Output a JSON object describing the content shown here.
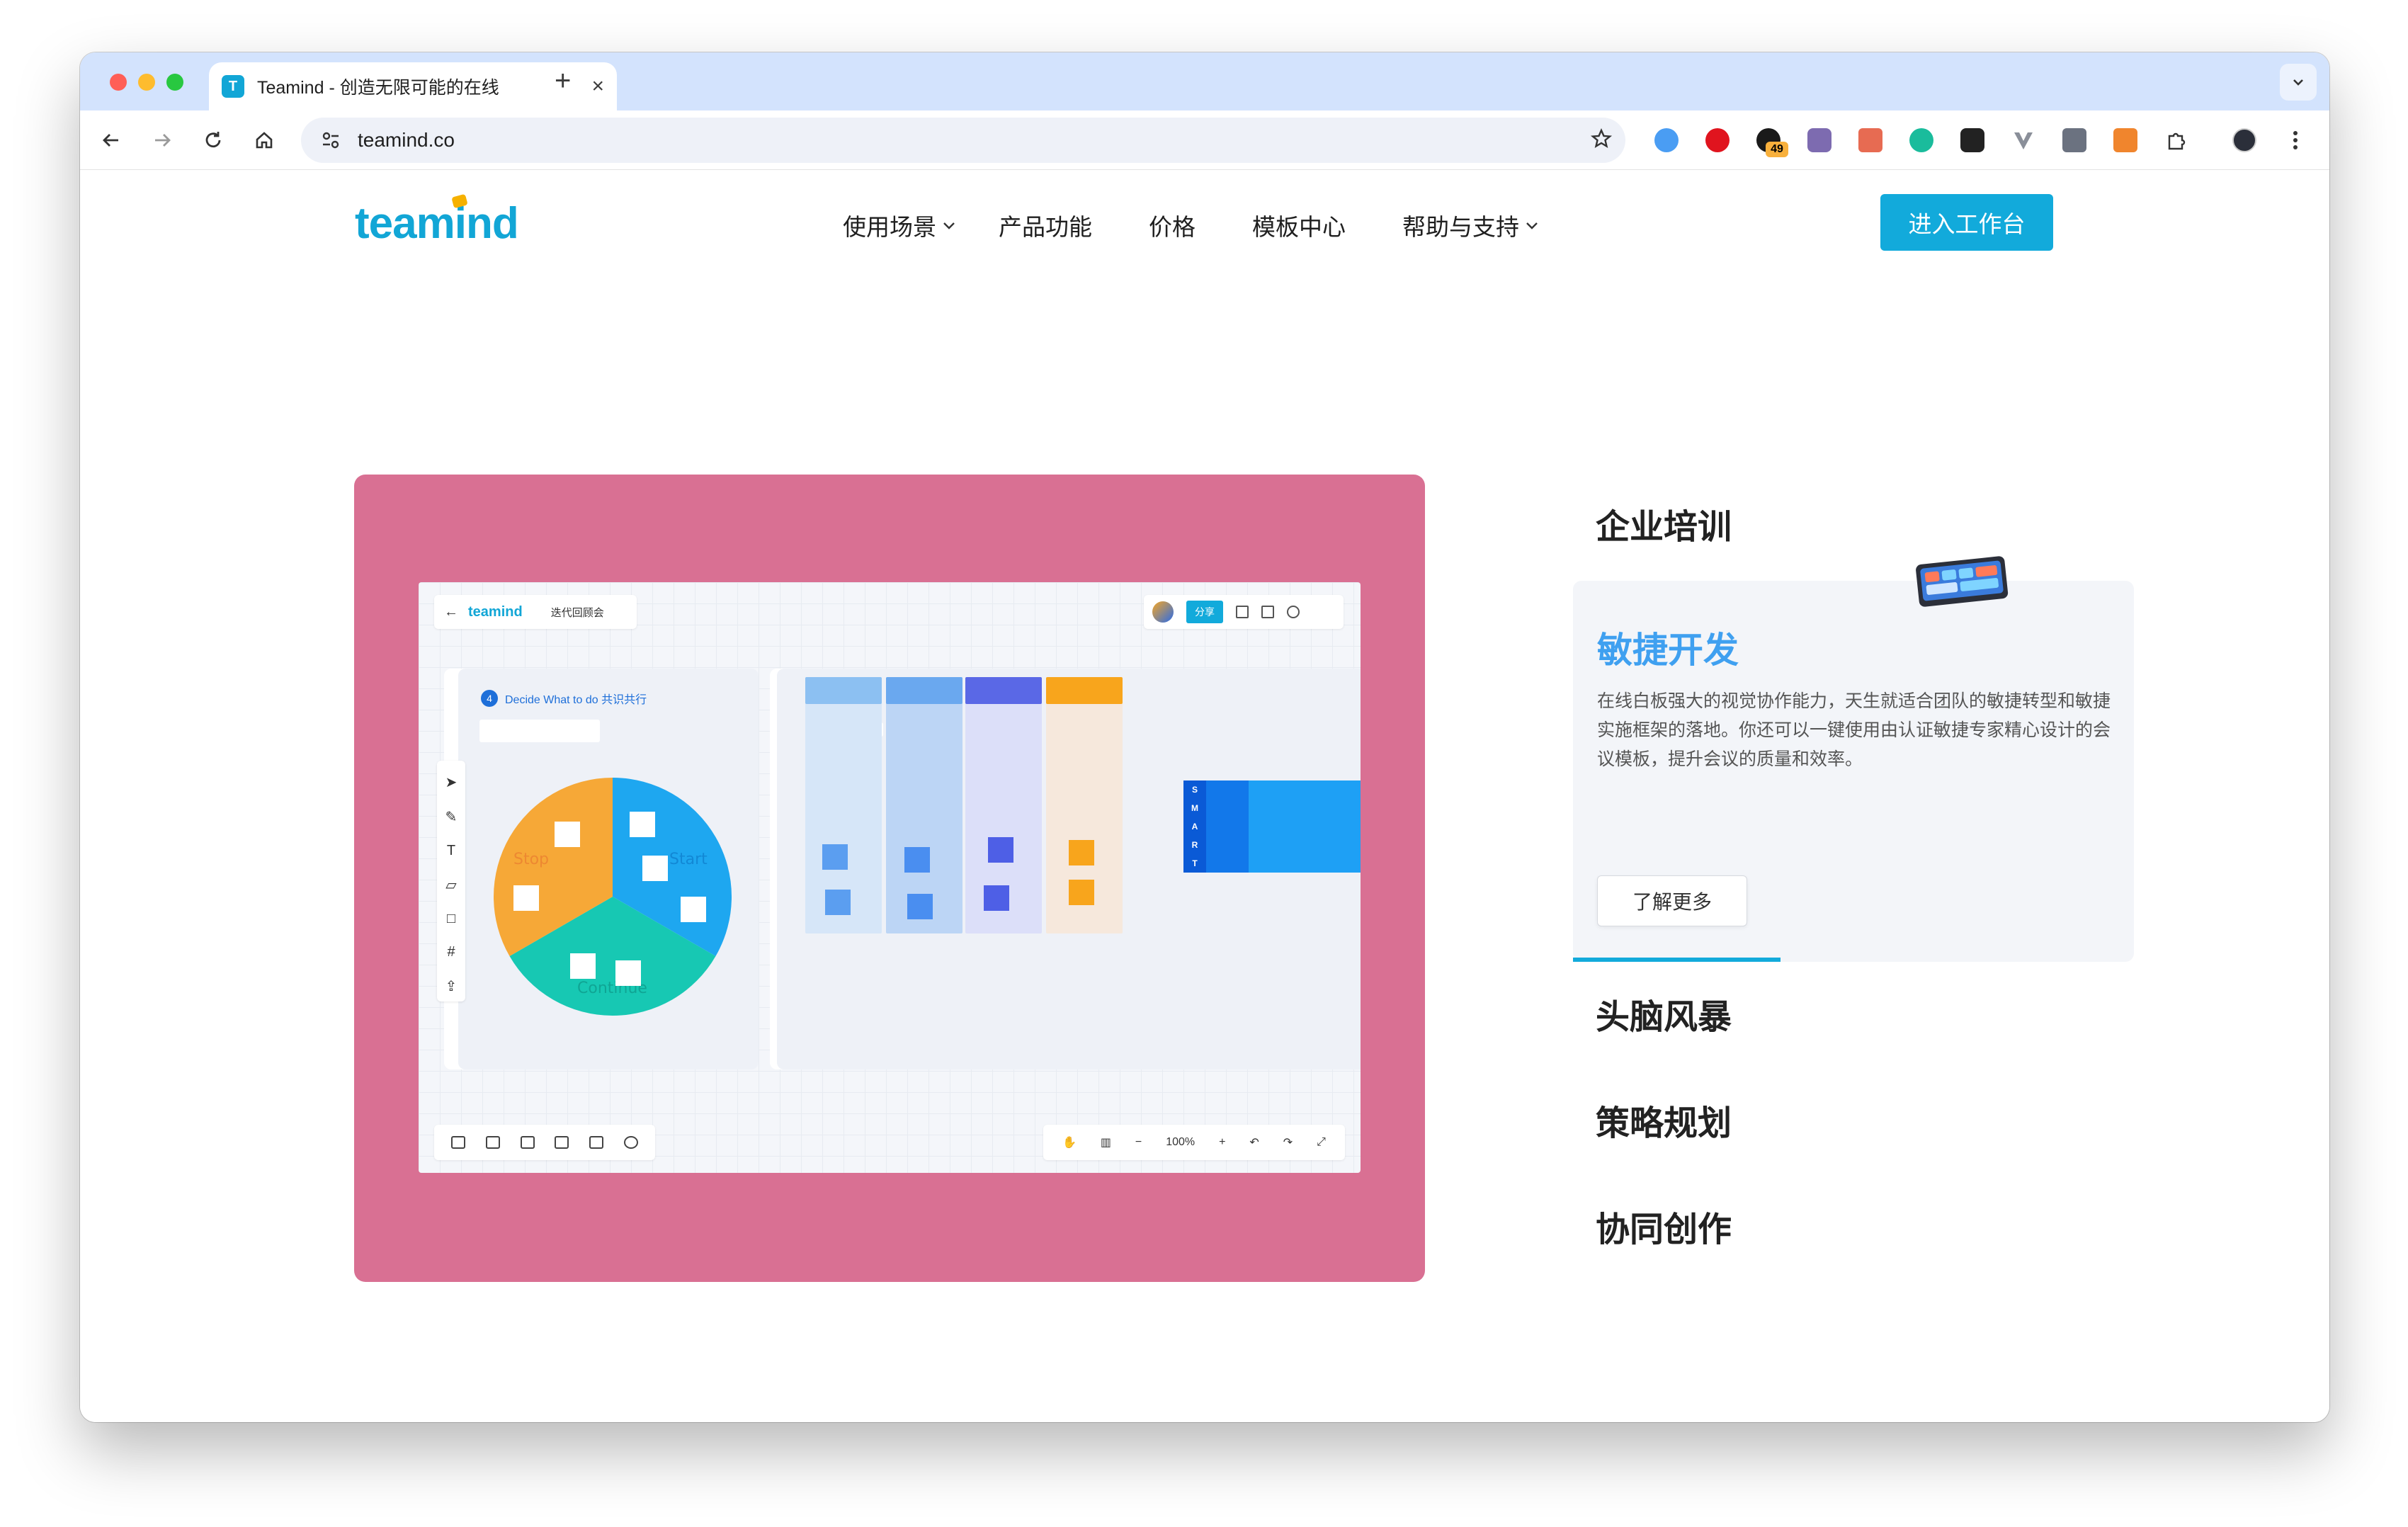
{
  "browser": {
    "tab_title": "Teamind - 创造无限可能的在线",
    "tab_favicon": "T",
    "url": "teamind.co",
    "extension_badge": "49"
  },
  "site": {
    "logo": "teamind",
    "nav": [
      {
        "label": "使用场景",
        "has_dropdown": true
      },
      {
        "label": "产品功能",
        "has_dropdown": false
      },
      {
        "label": "价格",
        "has_dropdown": false
      },
      {
        "label": "模板中心",
        "has_dropdown": false
      },
      {
        "label": "帮助与支持",
        "has_dropdown": true
      }
    ],
    "cta": "进入工作台"
  },
  "preview": {
    "logo": "teamind",
    "board_name": "迭代回顾会",
    "share": "分享",
    "frame_title": "Decide What to do  共识共行",
    "step": "4",
    "zoom": "100%",
    "pie_labels": [
      "Stop",
      "Start",
      "Continue"
    ],
    "smart_letters": [
      "S",
      "M",
      "A",
      "R",
      "T"
    ]
  },
  "features": {
    "items": [
      "企业培训",
      "敏捷开发",
      "头脑风暴",
      "策略规划",
      "协同创作"
    ],
    "active": {
      "title": "敏捷开发",
      "description": "在线白板强大的视觉协作能力，天生就适合团队的敏捷转型和敏捷实施框架的落地。你还可以一键使用由认证敏捷专家精心设计的会议模板，提升会议的质量和效率。",
      "button": "了解更多",
      "progress": 0.37
    }
  },
  "colors": {
    "brand": "#12aadb",
    "hero_bg": "#d97093",
    "active_title": "#3fa0f0"
  }
}
